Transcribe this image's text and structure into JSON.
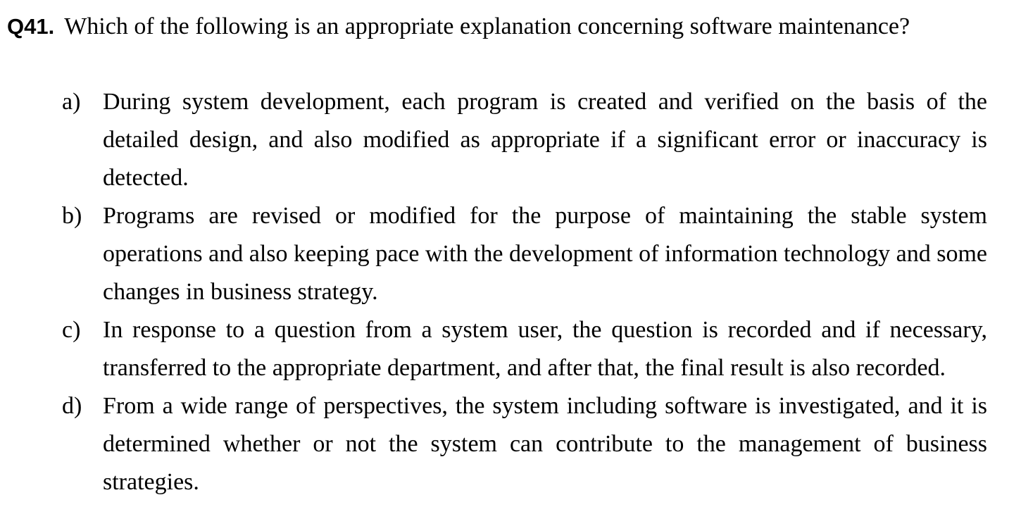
{
  "question": {
    "number": "Q41.",
    "text": "Which of the following is an appropriate explanation concerning software maintenance?"
  },
  "options": [
    {
      "label": "a)",
      "text": "During system development, each program is created and verified on the basis of the detailed design, and also modified as appropriate if a significant error or inaccuracy is detected."
    },
    {
      "label": "b)",
      "text": "Programs are revised or modified for the purpose of maintaining the stable system operations and also keeping pace with the development of information technology and some changes in business strategy."
    },
    {
      "label": "c)",
      "text": "In response to a question from a system user, the question is recorded and if necessary, transferred to the appropriate department, and after that, the final result is also recorded."
    },
    {
      "label": "d)",
      "text": "From a wide range of perspectives, the system including software is investigated, and it is determined whether or not the system can contribute to the management of business strategies."
    }
  ]
}
